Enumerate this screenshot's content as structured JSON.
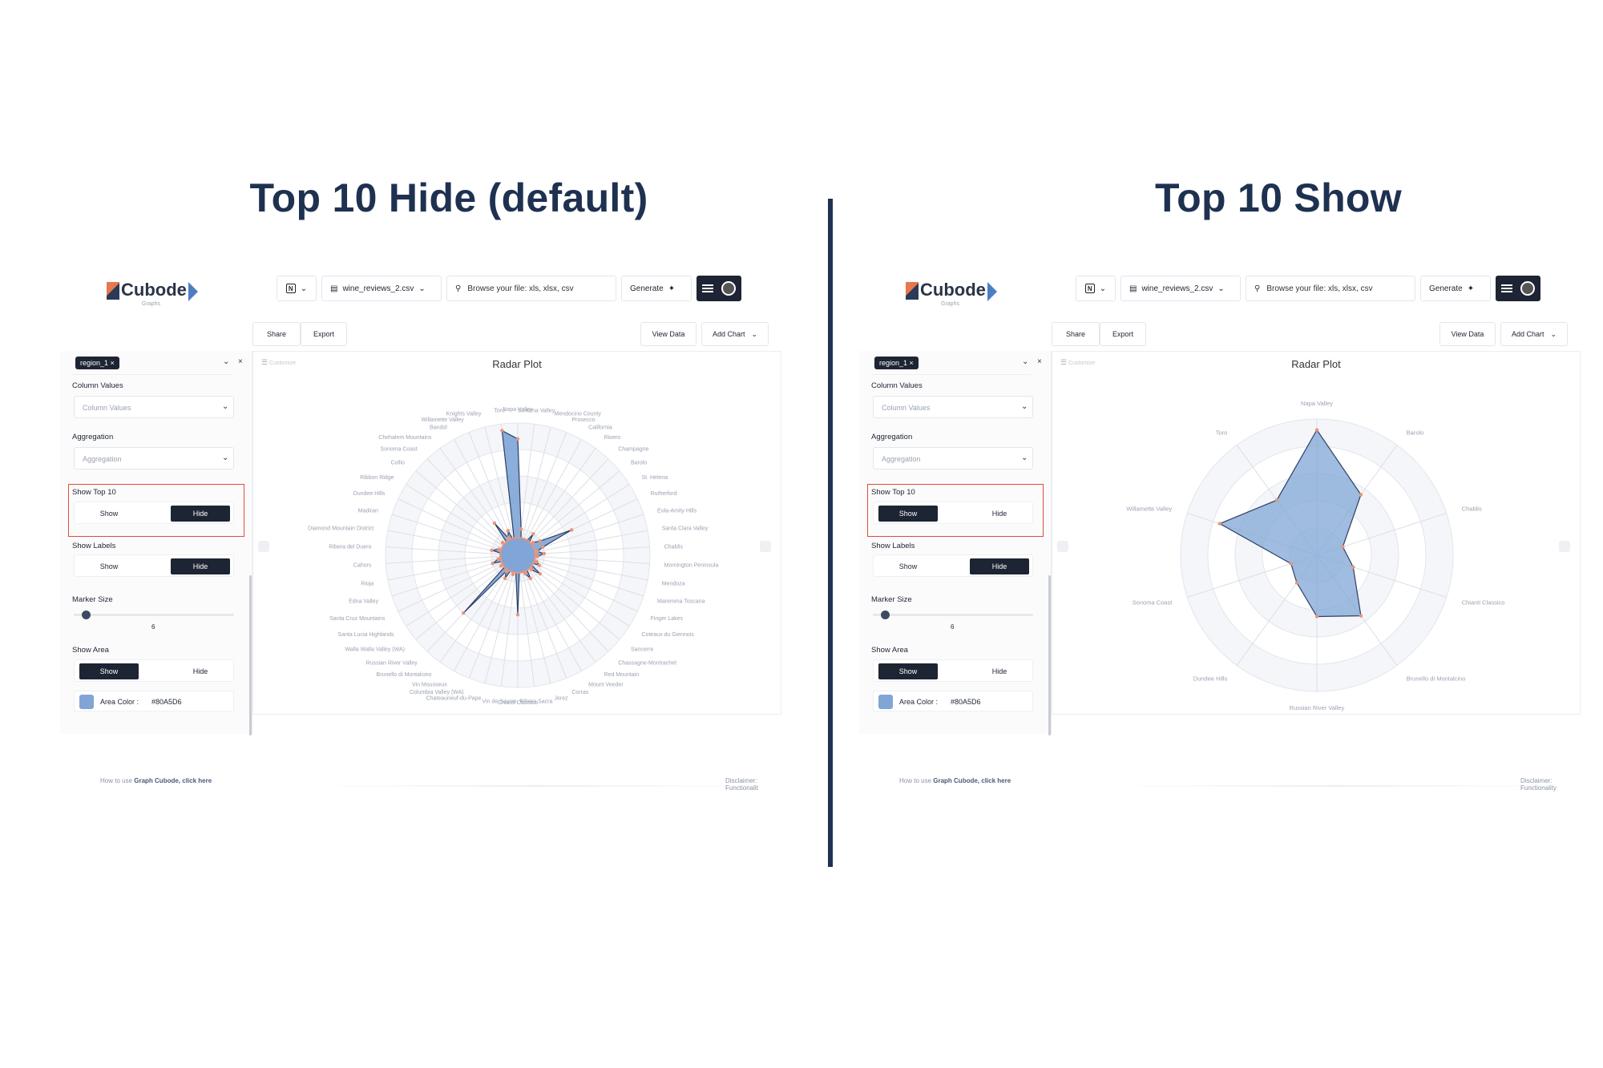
{
  "headings": {
    "left": "Top 10 Hide (default)",
    "right": "Top 10 Show"
  },
  "accent_dark": "#1d2433",
  "area_color": "#80A5D6",
  "highlight_color": "#e14b3b",
  "app": {
    "logo": "Cubode",
    "logo_sub": "Graphs",
    "toolbar": {
      "file": "wine_reviews_2.csv",
      "browse": "Browse your file: xls, xlsx, csv",
      "generate": "Generate"
    },
    "actions": {
      "share": "Share",
      "export": "Export",
      "view_data": "View Data",
      "add_chart": "Add Chart"
    },
    "sidebar": {
      "tag": "region_1 ×",
      "column_values_label": "Column Values",
      "column_values_placeholder": "Column Values",
      "aggregation_label": "Aggregation",
      "aggregation_placeholder": "Aggregation",
      "show_top10_label": "Show Top 10",
      "show_labels_label": "Show Labels",
      "marker_size_label": "Marker Size",
      "marker_size_value": "6",
      "show_area_label": "Show Area",
      "show": "Show",
      "hide": "Hide",
      "area_color_label": "Area Color :",
      "area_color_value": "#80A5D6"
    },
    "customize": "Customize",
    "footer_prefix": "How to use ",
    "footer_link": "Graph Cubode, click here",
    "disclaimer_left": "Disclaimer: Functionalit",
    "disclaimer_right": "Disclaimer: Functionality"
  },
  "states": {
    "left": {
      "top10": "hide",
      "labels": "hide",
      "area": "show"
    },
    "right": {
      "top10": "show",
      "labels": "hide",
      "area": "show"
    }
  },
  "chart_data": [
    {
      "type": "radar",
      "title": "Radar Plot",
      "categories": [
        "Napa Valley",
        "Sonoma Valley",
        "Mendocino County",
        "Prosecco",
        "California",
        "Rioero",
        "Champagne",
        "Barolo",
        "St. Helena",
        "Rutherford",
        "Eola-Amity Hills",
        "Santa Clara Valley",
        "Chablis",
        "Mornington Peninsula",
        "Mendoza",
        "Maremma Toscana",
        "Finger Lakes",
        "Coteaux du Giennois",
        "Sancerre",
        "Chassagne-Montrachet",
        "Red Mountain",
        "Mount Veeder",
        "Corras",
        "Jerez",
        "Ribera Sacra",
        "Chianti Classico",
        "Vin de Savoie",
        "Chateauneuf-du-Pape",
        "Columbia Valley (WA)",
        "Vin Mousseux",
        "Brunello di Montalcino",
        "Russian River Valley",
        "Walla Walla Valley (WA)",
        "Santa Lucia Highlands",
        "Santa Cruz Mountains",
        "Edna Valley",
        "Rioja",
        "Cahors",
        "Ribera del Duero",
        "Diamond Mountain District",
        "Madiran",
        "Dundee Hills",
        "Ribbon Ridge",
        "Collio",
        "Sonoma Coast",
        "Chehalem Mountains",
        "Bandol",
        "Willamette Valley",
        "Knights Valley",
        "Toro"
      ],
      "values": [
        0.88,
        0.2,
        0.1,
        0.12,
        0.1,
        0.2,
        0.12,
        0.15,
        0.2,
        0.45,
        0.2,
        0.15,
        0.2,
        0.15,
        0.1,
        0.15,
        0.18,
        0.1,
        0.22,
        0.15,
        0.1,
        0.2,
        0.15,
        0.12,
        0.1,
        0.45,
        0.12,
        0.15,
        0.1,
        0.2,
        0.15,
        0.6,
        0.1,
        0.15,
        0.1,
        0.2,
        0.15,
        0.12,
        0.1,
        0.2,
        0.15,
        0.1,
        0.12,
        0.15,
        0.1,
        0.3,
        0.15,
        0.2,
        0.1,
        0.95
      ],
      "show_labels": false,
      "show_area": true,
      "top10": false
    },
    {
      "type": "radar",
      "title": "Radar Plot",
      "categories": [
        "Napa Valley",
        "Barolo",
        "Chablis",
        "Chianti Classico",
        "Brunello di Montalcino",
        "Russian River Valley",
        "Dundee Hills",
        "Sonoma Coast",
        "Willamette Valley",
        "Toro"
      ],
      "values": [
        0.92,
        0.55,
        0.2,
        0.28,
        0.55,
        0.45,
        0.25,
        0.2,
        0.75,
        0.5
      ],
      "show_labels": false,
      "show_area": true,
      "top10": true
    }
  ]
}
